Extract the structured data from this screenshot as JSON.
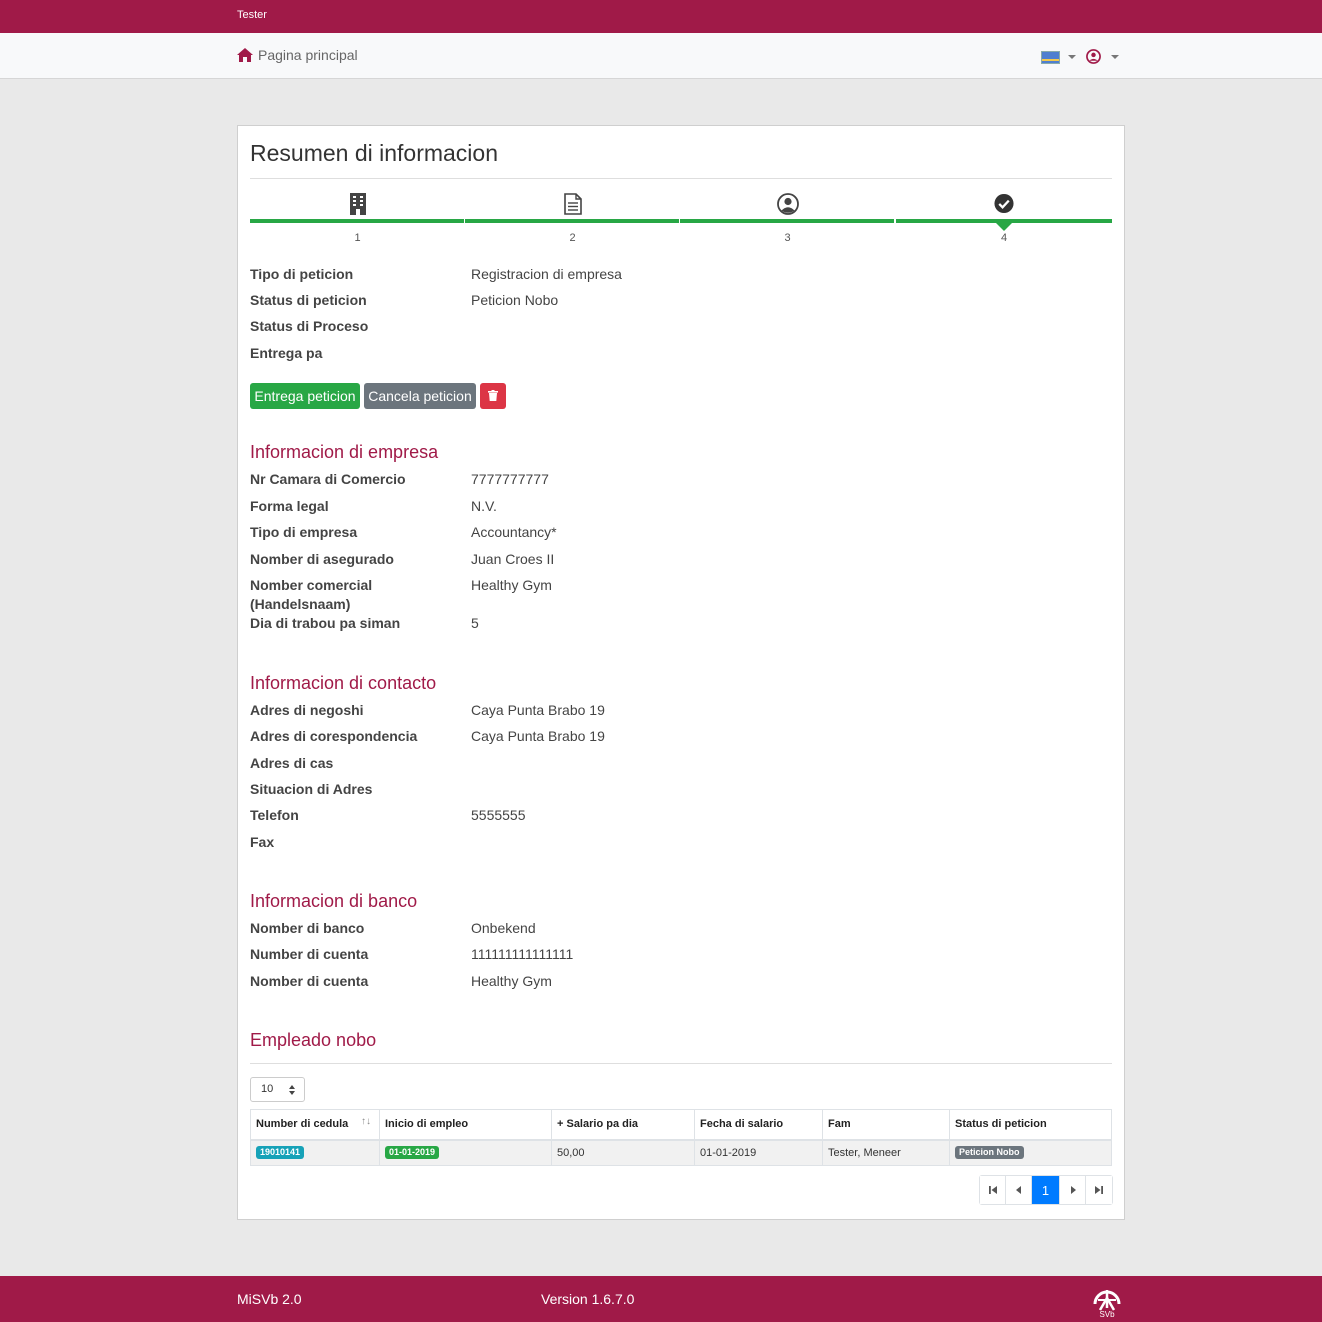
{
  "topbar": {
    "user": "Tester"
  },
  "navbar": {
    "home_label": "Pagina principal"
  },
  "card": {
    "title": "Resumen di informacion",
    "steps": [
      {
        "num": "1",
        "icon": "building-icon"
      },
      {
        "num": "2",
        "icon": "document-icon"
      },
      {
        "num": "3",
        "icon": "user-circle-icon"
      },
      {
        "num": "4",
        "icon": "check-circle-icon"
      }
    ],
    "summary": [
      {
        "label": "Tipo di peticion",
        "value": "Registracion di empresa"
      },
      {
        "label": "Status di peticion",
        "value": "Peticion Nobo"
      },
      {
        "label": "Status di Proceso",
        "value": ""
      },
      {
        "label": "Entrega pa",
        "value": ""
      }
    ],
    "buttons": {
      "submit": "Entrega peticion",
      "cancel": "Cancela peticion"
    },
    "empresa": {
      "title": "Informacion di empresa",
      "rows": [
        {
          "label": "Nr Camara di Comercio",
          "value": "7777777777"
        },
        {
          "label": "Forma legal",
          "value": "N.V."
        },
        {
          "label": "Tipo di empresa",
          "value": "Accountancy*"
        },
        {
          "label": "Nomber di asegurado",
          "value": "Juan Croes II"
        },
        {
          "label": "Nomber comercial",
          "label2": "(Handelsnaam)",
          "value": "Healthy Gym"
        },
        {
          "label": "Dia di trabou pa siman",
          "value": "5"
        }
      ]
    },
    "contacto": {
      "title": "Informacion di contacto",
      "rows": [
        {
          "label": "Adres di negoshi",
          "value": "Caya Punta Brabo 19"
        },
        {
          "label": "Adres di corespondencia",
          "value": "Caya Punta Brabo 19"
        },
        {
          "label": "Adres di cas",
          "value": ""
        },
        {
          "label": "Situacion di Adres",
          "value": ""
        },
        {
          "label": "Telefon",
          "value": "5555555"
        },
        {
          "label": "Fax",
          "value": ""
        }
      ]
    },
    "banco": {
      "title": "Informacion di banco",
      "rows": [
        {
          "label": "Nomber di banco",
          "value": "Onbekend"
        },
        {
          "label": "Number di cuenta",
          "value": "111111111111111"
        },
        {
          "label": "Nomber di cuenta",
          "value": "Healthy Gym"
        }
      ]
    },
    "empleado": {
      "title": "Empleado nobo",
      "page_size": "10",
      "columns": [
        "Number di cedula",
        "Inicio di empleo",
        "+ Salario pa dia",
        "Fecha di salario",
        "Fam",
        "Status di peticion"
      ],
      "rows": [
        {
          "cedula": "19010141",
          "inicio": "01-01-2019",
          "salario": "50,00",
          "fecha": "01-01-2019",
          "fam": "Tester, Meneer",
          "status": "Peticion Nobo"
        }
      ],
      "current_page": "1"
    }
  },
  "footer": {
    "name": "MiSVb 2.0",
    "version": "Version 1.6.7.0",
    "logo_text": "SVb"
  },
  "colors": {
    "brand": "#a01a48",
    "success": "#28a745",
    "secondary": "#6c757d",
    "danger": "#dc3545",
    "primary": "#007bff",
    "info": "#17a2b8"
  }
}
